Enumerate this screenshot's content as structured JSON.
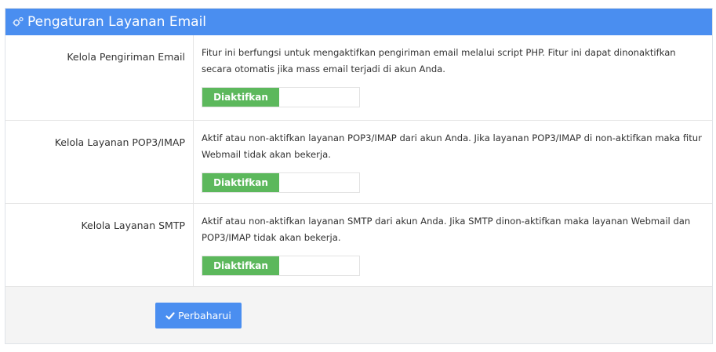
{
  "header": {
    "title": "Pengaturan Layanan Email",
    "icon": "cogs-icon"
  },
  "rows": [
    {
      "label": "Kelola Pengiriman Email",
      "description": "Fitur ini berfungsi untuk mengaktifkan pengiriman email melalui script PHP. Fitur ini dapat dinonaktifkan secara otomatis jika mass email terjadi di akun Anda.",
      "toggle_label": "Diaktifkan"
    },
    {
      "label": "Kelola Layanan POP3/IMAP",
      "description": "Aktif atau non-aktifkan layanan POP3/IMAP dari akun Anda. Jika layanan POP3/IMAP di non-aktifkan maka fitur Webmail tidak akan bekerja.",
      "toggle_label": "Diaktifkan"
    },
    {
      "label": "Kelola Layanan SMTP",
      "description": "Aktif atau non-aktifkan layanan SMTP dari akun Anda. Jika SMTP dinon-aktifkan maka layanan Webmail dan POP3/IMAP tidak akan bekerja.",
      "toggle_label": "Diaktifkan"
    }
  ],
  "footer": {
    "submit_label": "Perbaharui",
    "submit_icon": "check-icon"
  },
  "colors": {
    "header": "#4a8ef0",
    "toggle_on": "#5cb85c",
    "button": "#4a8ef0"
  }
}
